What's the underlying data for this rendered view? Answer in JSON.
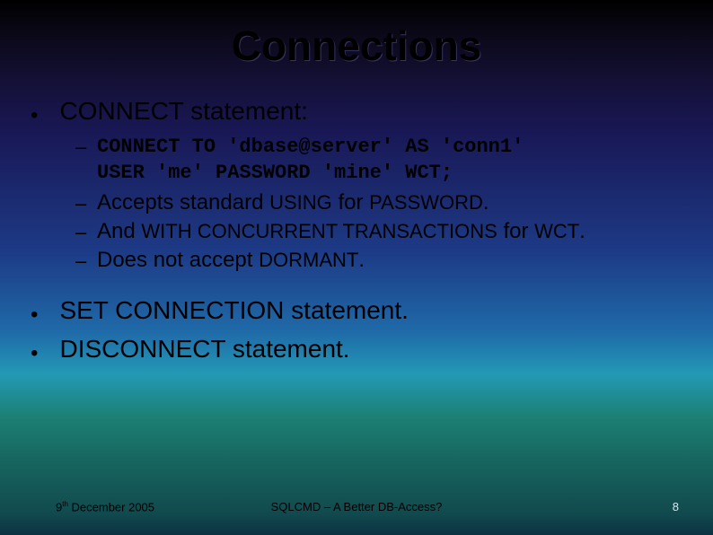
{
  "title": "Connections",
  "bullets": {
    "b1": "CONNECT statement:",
    "code": "CONNECT TO 'dbase@server' AS 'conn1'\nUSER 'me' PASSWORD 'mine' WCT;",
    "sub1_a": "Accepts standard ",
    "sub1_b": "USING",
    "sub1_c": " for ",
    "sub1_d": "PASSWORD",
    "sub1_e": ".",
    "sub2_a": "And ",
    "sub2_b": "WITH CONCURRENT TRANSACTIONS",
    "sub2_c": " for ",
    "sub2_d": "WCT",
    "sub2_e": ".",
    "sub3_a": "Does not accept ",
    "sub3_b": "DORMANT",
    "sub3_c": ".",
    "b2": "SET CONNECTION statement.",
    "b3": "DISCONNECT statement."
  },
  "footer": {
    "date_day": "9",
    "date_sup": "th",
    "date_rest": " December 2005",
    "center": "SQLCMD – A Better DB-Access?",
    "pagenum": "8"
  }
}
